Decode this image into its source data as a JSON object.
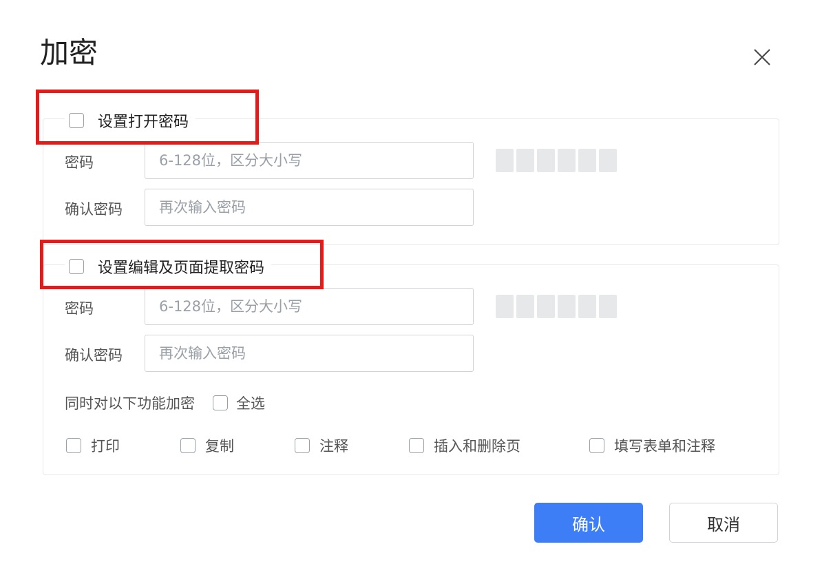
{
  "dialog": {
    "title": "加密"
  },
  "open_section": {
    "label": "设置打开密码",
    "password_label": "密码",
    "password_placeholder": "6-128位，区分大小写",
    "confirm_label": "确认密码",
    "confirm_placeholder": "再次输入密码"
  },
  "edit_section": {
    "label": "设置编辑及页面提取密码",
    "password_label": "密码",
    "password_placeholder": "6-128位，区分大小写",
    "confirm_label": "确认密码",
    "confirm_placeholder": "再次输入密码",
    "also_label": "同时对以下功能加密",
    "select_all": "全选",
    "options": [
      "打印",
      "复制",
      "注释",
      "插入和删除页",
      "填写表单和注释"
    ]
  },
  "buttons": {
    "ok": "确认",
    "cancel": "取消"
  },
  "colors": {
    "accent": "#3d7ef7",
    "highlight": "#e21b1b"
  },
  "icons": {
    "close": "close-icon"
  }
}
